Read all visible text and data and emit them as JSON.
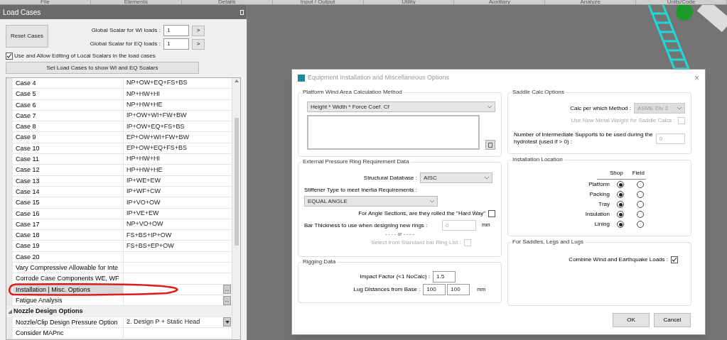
{
  "menu": [
    "File",
    "Elements",
    "Details",
    "Input / Output",
    "Utility",
    "Auxiliary",
    "Analyze",
    "Units/Code"
  ],
  "panel": {
    "title": "Load Cases",
    "reset_button": "Reset Cases",
    "scalars": [
      {
        "label": "Global Scalar for WI loads :",
        "value": "1",
        "button": ">"
      },
      {
        "label": "Global Scalar for EQ loads :",
        "value": "1",
        "button": ">"
      }
    ],
    "local_scalars": {
      "label": "Use and Allow Editing of Local Scalars in the load cases",
      "checked": true
    },
    "set_button": "Set Load Cases to show WI and EQ Scalars",
    "rows": [
      {
        "kind": "row",
        "label": "Case 4",
        "value": "NP+OW+EQ+FS+BS",
        "selected": false
      },
      {
        "kind": "row",
        "label": "Case 5",
        "value": "NP+HW+HI",
        "selected": false
      },
      {
        "kind": "row",
        "label": "Case 6",
        "value": "NP+HW+HE",
        "selected": false
      },
      {
        "kind": "row",
        "label": "Case 7",
        "value": "IP+OW+WI+FW+BW",
        "selected": false
      },
      {
        "kind": "row",
        "label": "Case 8",
        "value": "IP+OW+EQ+FS+BS",
        "selected": false
      },
      {
        "kind": "row",
        "label": "Case 9",
        "value": "EP+OW+WI+FW+BW",
        "selected": false
      },
      {
        "kind": "row",
        "label": "Case 10",
        "value": "EP+OW+EQ+FS+BS",
        "selected": false
      },
      {
        "kind": "row",
        "label": "Case 11",
        "value": "HP+HW+HI",
        "selected": false
      },
      {
        "kind": "row",
        "label": "Case 12",
        "value": "HP+HW+HE",
        "selected": false
      },
      {
        "kind": "row",
        "label": "Case 13",
        "value": "IP+WE+EW",
        "selected": false
      },
      {
        "kind": "row",
        "label": "Case 14",
        "value": "IP+WF+CW",
        "selected": false
      },
      {
        "kind": "row",
        "label": "Case 15",
        "value": "IP+VO+OW",
        "selected": false
      },
      {
        "kind": "row",
        "label": "Case 16",
        "value": "IP+VE+EW",
        "selected": false
      },
      {
        "kind": "row",
        "label": "Case 17",
        "value": "NP+VO+OW",
        "selected": false
      },
      {
        "kind": "row",
        "label": "Case 18",
        "value": "FS+BS+IP+OW",
        "selected": false
      },
      {
        "kind": "row",
        "label": "Case 19",
        "value": "FS+BS+EP+OW",
        "selected": false
      },
      {
        "kind": "row",
        "label": "Case 20",
        "value": "",
        "selected": false
      },
      {
        "kind": "row",
        "label": "Vary Compressive Allowable for Inte",
        "value": "",
        "selected": false
      },
      {
        "kind": "row",
        "label": "Corrode Case Components WE, WF",
        "value": "",
        "selected": false
      },
      {
        "kind": "ellipsis",
        "label": "Installation | Misc. Options",
        "value": "",
        "button": "...",
        "selected": true
      },
      {
        "kind": "ellipsis",
        "label": "Fatigue Analysis",
        "value": "",
        "button": "...",
        "selected": false
      },
      {
        "kind": "section",
        "label": "Nozzle Design Options",
        "expanded": true
      },
      {
        "kind": "dropdown",
        "label": "Nozzle/Clip Design Pressure Option",
        "value": "2. Design P + Static Head",
        "selected": false
      },
      {
        "kind": "row",
        "label": "Consider MAPnc",
        "value": "",
        "selected": false
      }
    ]
  },
  "dialog": {
    "title": "Equipment Installation and Miscellaneous Options",
    "close": "×",
    "platform": {
      "title": "Platform Wind Area Calculation Method",
      "method": "Height * Width * Force Coef. Cf"
    },
    "ring": {
      "title": "External Pressure Ring Requirement  Data",
      "db_label": "Structural Database :",
      "db_value": "AISC",
      "stiffener_label": "Stiffener Type to  meet Inertia Requirements :",
      "stiffener_value": "EQUAL ANGLE",
      "hard_way": {
        "label": "For Angle Sections, are they rolled the \"Hard Way\"",
        "checked": false
      },
      "bar_label": "Bar Thickness to use when designing new rings :",
      "bar_value": "0",
      "bar_unit": "mm",
      "or": "- - - - or - - - -",
      "standard": {
        "label": "Select from Standard bar Ring List :",
        "checked": false,
        "disabled": true
      }
    },
    "rigging": {
      "title": "Rigging Data",
      "impact_label": "Impact Factor  (<1 NoCalc) :",
      "impact_value": "1.5",
      "lug_label": "Lug Distances from Base :",
      "lug_values": [
        "100",
        "100"
      ],
      "lug_unit": "mm"
    },
    "saddle": {
      "title": "Saddle Calc Options",
      "method_label": "Calc per which Method :",
      "method_value": "ASME Div 2",
      "method_disabled": true,
      "metal": {
        "label": "Use New Metal Weight for Saddle Calcs :",
        "checked": false,
        "disabled": true
      },
      "supports_label": "Number of Intermediate Supports to be used during the hydrotest (used if > 0) :",
      "supports_value": "0"
    },
    "location": {
      "title": "Installation Location",
      "columns": [
        "Shop",
        "Field"
      ],
      "rows": [
        {
          "label": "Platform",
          "shop": true,
          "field": false
        },
        {
          "label": "Packing",
          "shop": true,
          "field": false
        },
        {
          "label": "Tray",
          "shop": true,
          "field": false
        },
        {
          "label": "Insulation",
          "shop": true,
          "field": false
        },
        {
          "label": "Lining",
          "shop": true,
          "field": false
        }
      ]
    },
    "lugs": {
      "title": "For Saddles, Legs and Lugs",
      "combine": {
        "label": "Combine Wind and Earthquake Loads :",
        "checked": true
      }
    },
    "buttons": [
      "OK",
      "Cancel"
    ]
  }
}
